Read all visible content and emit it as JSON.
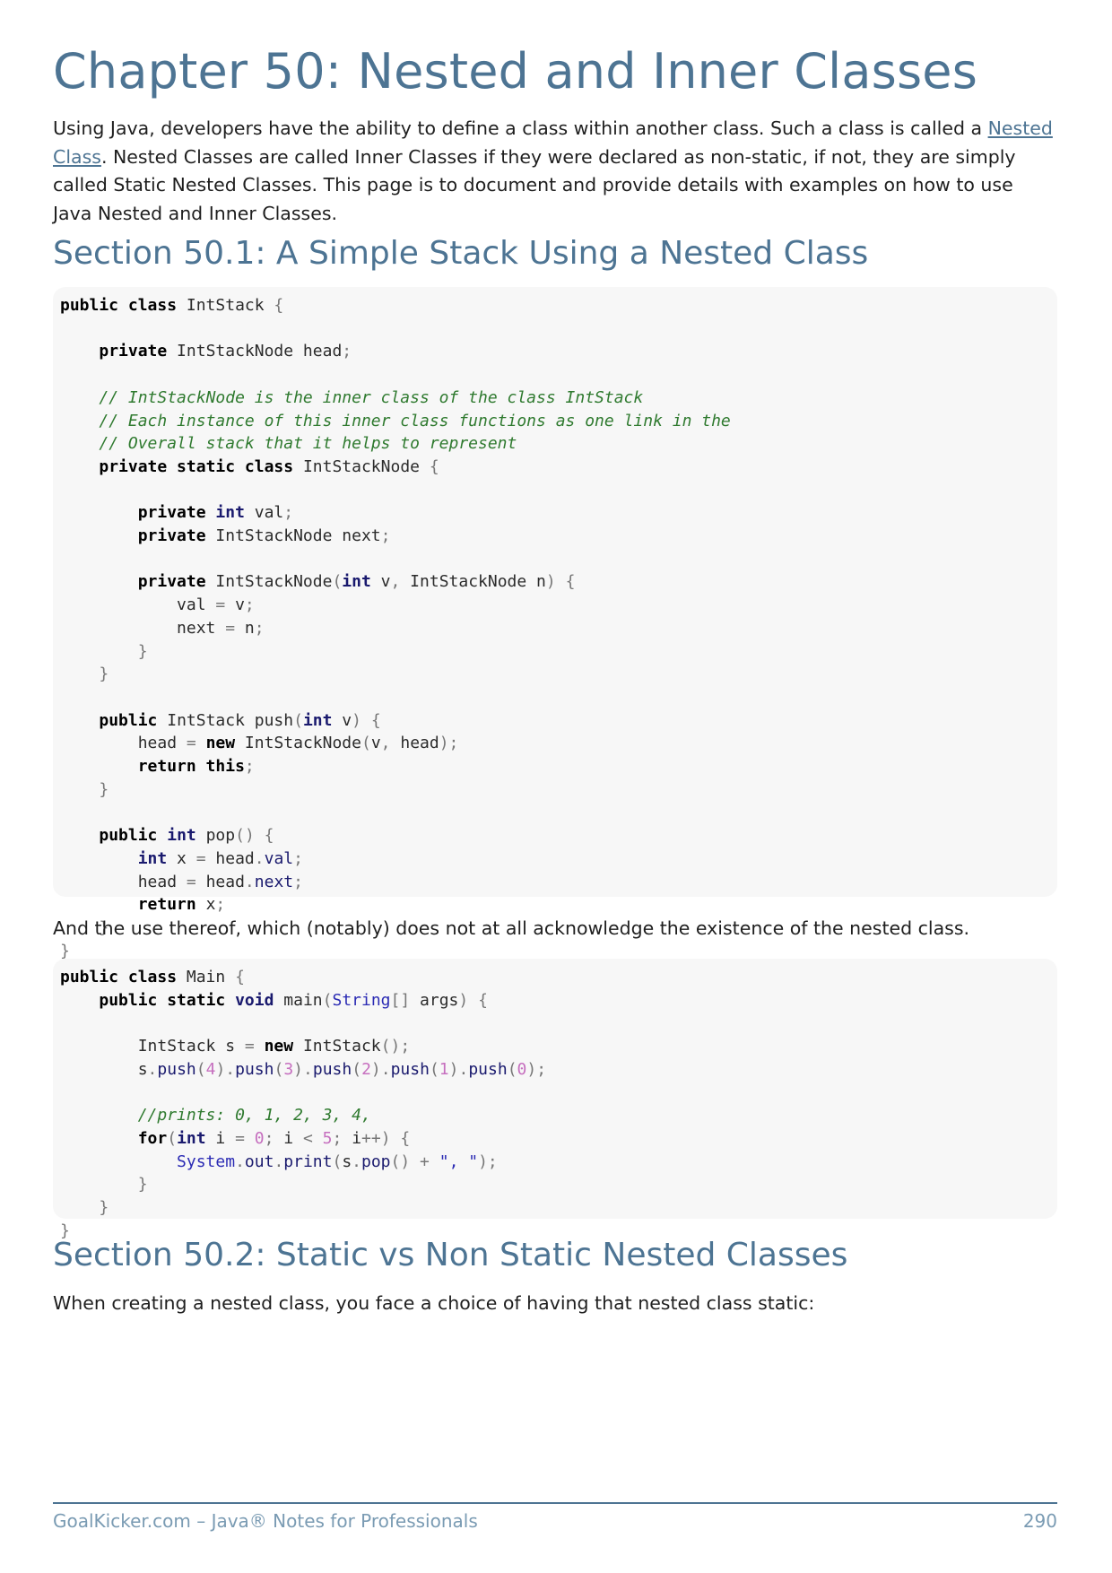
{
  "chapter_title": "Chapter 50: Nested and Inner Classes",
  "intro": {
    "text_before_link": "Using Java, developers have the ability to define a class within another class. Such a class is called a ",
    "link_text": "Nested Class",
    "text_after_link": ". Nested Classes are called Inner Classes if they were declared as non-static, if not, they are simply called Static Nested Classes. This page is to document and provide details with examples on how to use Java Nested and Inner Classes."
  },
  "section_1": {
    "title": "Section 50.1: A Simple Stack Using a Nested Class",
    "between_text": "And the use thereof, which (notably) does not at all acknowledge the existence of the nested class."
  },
  "section_2": {
    "title": "Section 50.2: Static vs Non Static Nested Classes",
    "text": "When creating a nested class, you face a choice of having that nested class static:"
  },
  "footer": {
    "left": "GoalKicker.com – Java® Notes for Professionals",
    "page_number": "290"
  }
}
